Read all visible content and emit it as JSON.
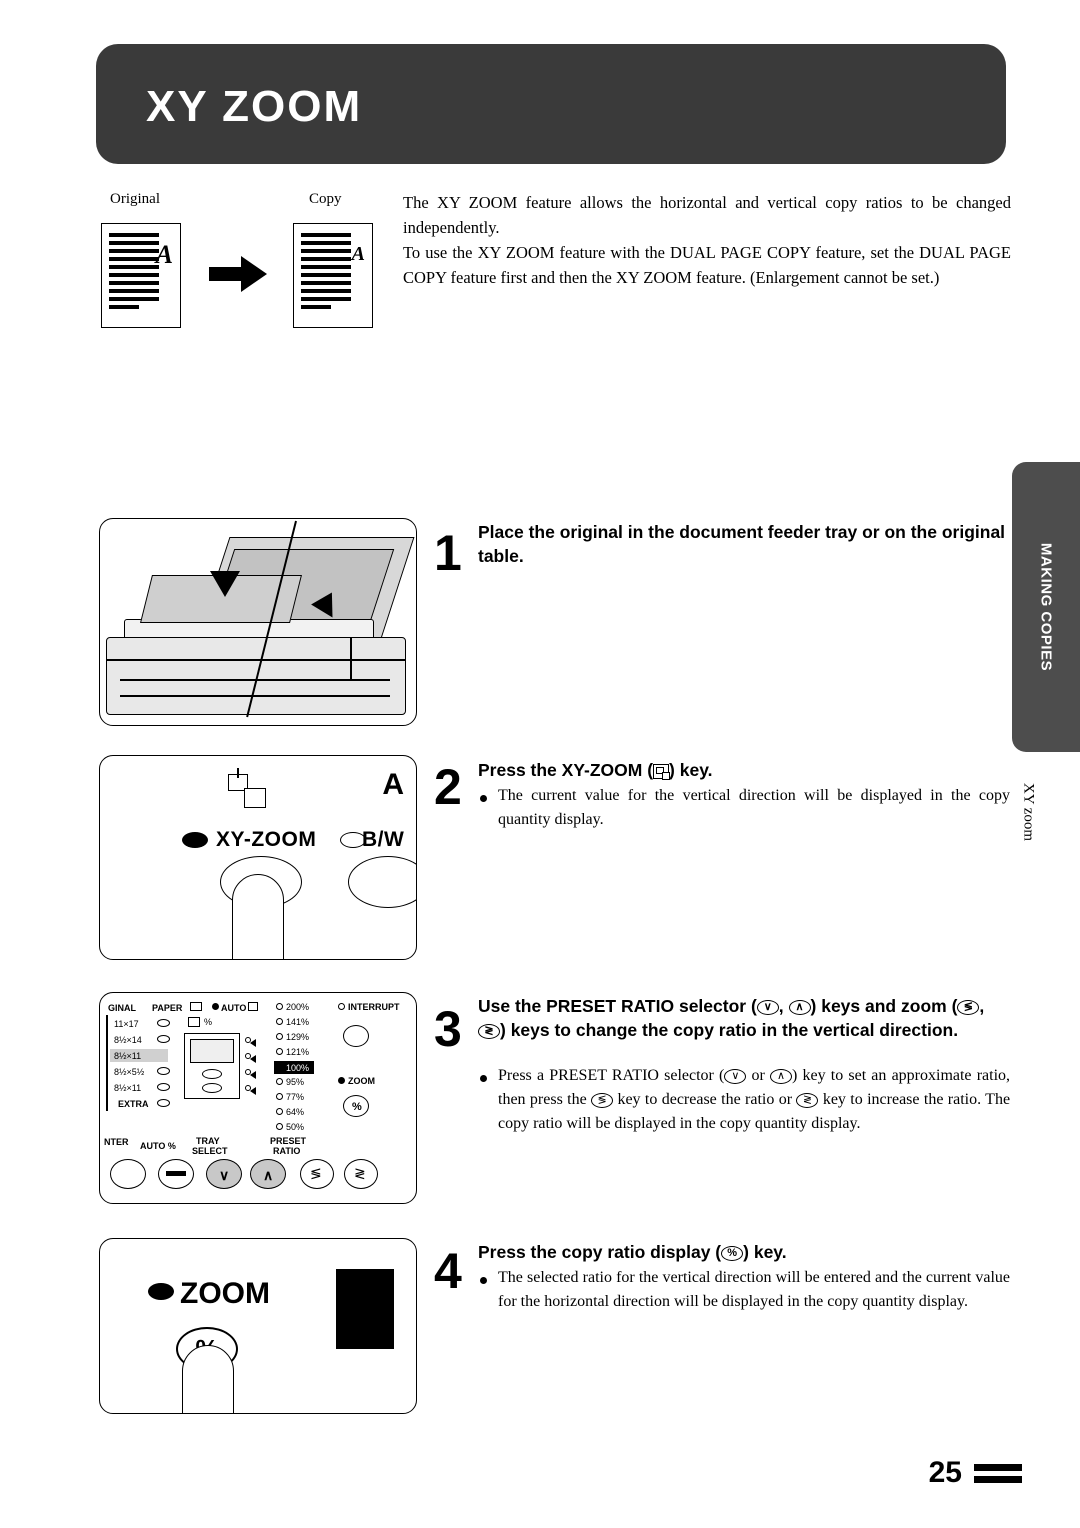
{
  "page": {
    "title": "XY ZOOM",
    "number": "25",
    "side_tab": "MAKING COPIES",
    "side_sub": "XY zoom"
  },
  "intro": {
    "label_original": "Original",
    "label_copy": "Copy",
    "paragraph1": "The XY ZOOM feature allows the horizontal and vertical copy ratios to be changed independently.",
    "paragraph2": "To use the XY ZOOM feature with the DUAL PAGE COPY feature, set the DUAL PAGE COPY feature first and then the XY ZOOM feature. (Enlargement cannot be set.)",
    "doc_letter": "A"
  },
  "steps": [
    {
      "number": "1",
      "heading": "Place the original in the document feeder tray or on the original table.",
      "body": ""
    },
    {
      "number": "2",
      "heading_pre": "Press the XY-ZOOM (",
      "heading_post": ") key.",
      "body": "The current value for the vertical direction will be displayed in the copy quantity display."
    },
    {
      "number": "3",
      "heading_line1_pre": "Use the PRESET RATIO selector (",
      "heading_line1_mid": ",",
      "heading_line1_post": ") keys and",
      "heading_line2_pre": "zoom (",
      "heading_line2_mid": ",",
      "heading_line2_post": ") keys to change the copy ratio in the",
      "heading_line3": "vertical direction.",
      "body_1": "Press a PRESET RATIO selector (",
      "body_2": "or",
      "body_3": ") key to set an approximate ratio, then press the",
      "body_4": "key to decrease the ratio or",
      "body_5": "key to increase the ratio. The copy ratio will be displayed in the copy quantity display."
    },
    {
      "number": "4",
      "heading_pre": "Press the copy ratio display (",
      "heading_post": ") key.",
      "body": "The selected ratio for the vertical direction will be entered and the current value for the horizontal direction will be displayed in the copy quantity display."
    }
  ],
  "figure2": {
    "label_xyzoom": "XY-ZOOM",
    "label_bw": "B/W",
    "label_a": "A"
  },
  "figure3": {
    "col_original": "GINAL",
    "col_paper": "PAPER",
    "auto_paper": "AUTO",
    "interrupt": "INTERRUPT",
    "sizes": [
      "11×17",
      "8½×14",
      "8½×11",
      "8½×5½",
      "8½×11",
      "EXTRA"
    ],
    "ratios": [
      "200%",
      "141%",
      "129%",
      "121%",
      "100%",
      "95%",
      "77%",
      "64%",
      "50%"
    ],
    "selected_ratio": "100%",
    "zoom_label": "ZOOM",
    "percent_label": "%",
    "bottom_labels": [
      "NTER",
      "AUTO %",
      "TRAY SELECT",
      "PRESET RATIO"
    ],
    "tray_label_1": "TRAY",
    "tray_label_2": "SELECT",
    "preset_label_1": "PRESET",
    "preset_label_2": "RATIO",
    "auto_pct": "AUTO %",
    "enter": "NTER"
  },
  "figure4": {
    "zoom_label": "ZOOM",
    "percent": "%"
  }
}
